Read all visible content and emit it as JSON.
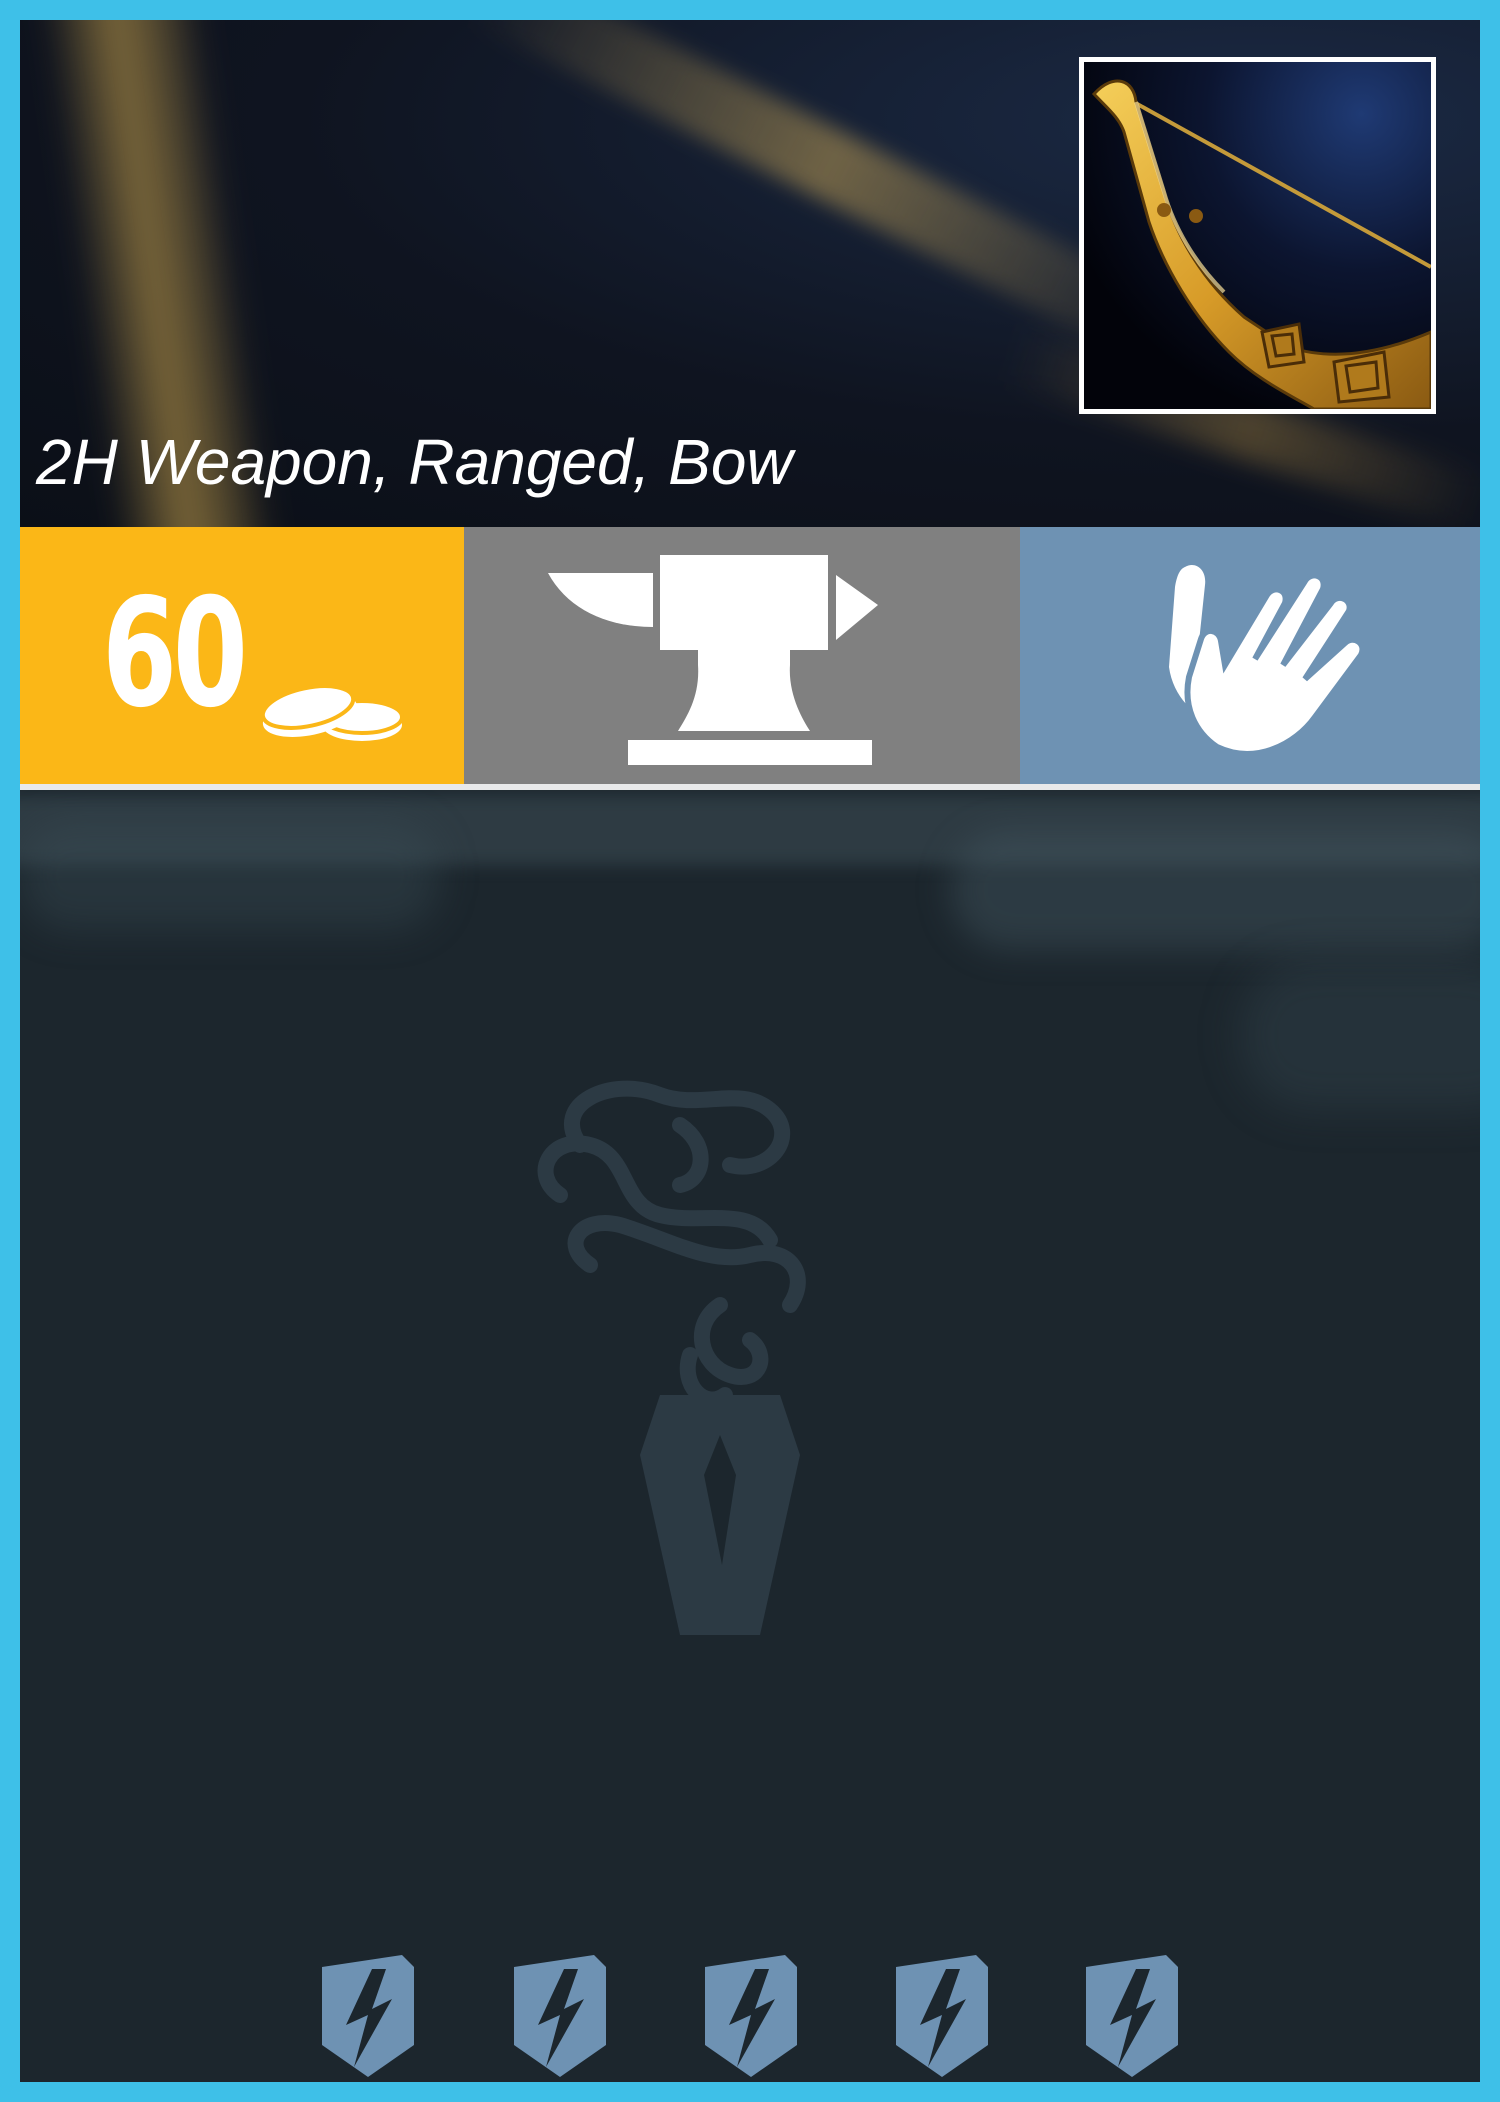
{
  "item": {
    "type_line": "2H Weapon, Ranged, Bow",
    "icon": "golden-bow-icon"
  },
  "stats": {
    "cost": "60",
    "cost_icon": "coins-icon",
    "craft_icon": "anvil-icon",
    "slot_icon": "hands-icon"
  },
  "emblem_icon": "smoke-coffin-emblem",
  "upgrade_pips": [
    "lightning-shield-icon",
    "lightning-shield-icon",
    "lightning-shield-icon",
    "lightning-shield-icon",
    "lightning-shield-icon"
  ],
  "colors": {
    "frame": "#3ec0e8",
    "cost_bg": "#fbb717",
    "craft_bg": "#808080",
    "slot_bg": "#6e92b3",
    "body_bg": "#1c262d",
    "pip": "#6e92b3"
  }
}
